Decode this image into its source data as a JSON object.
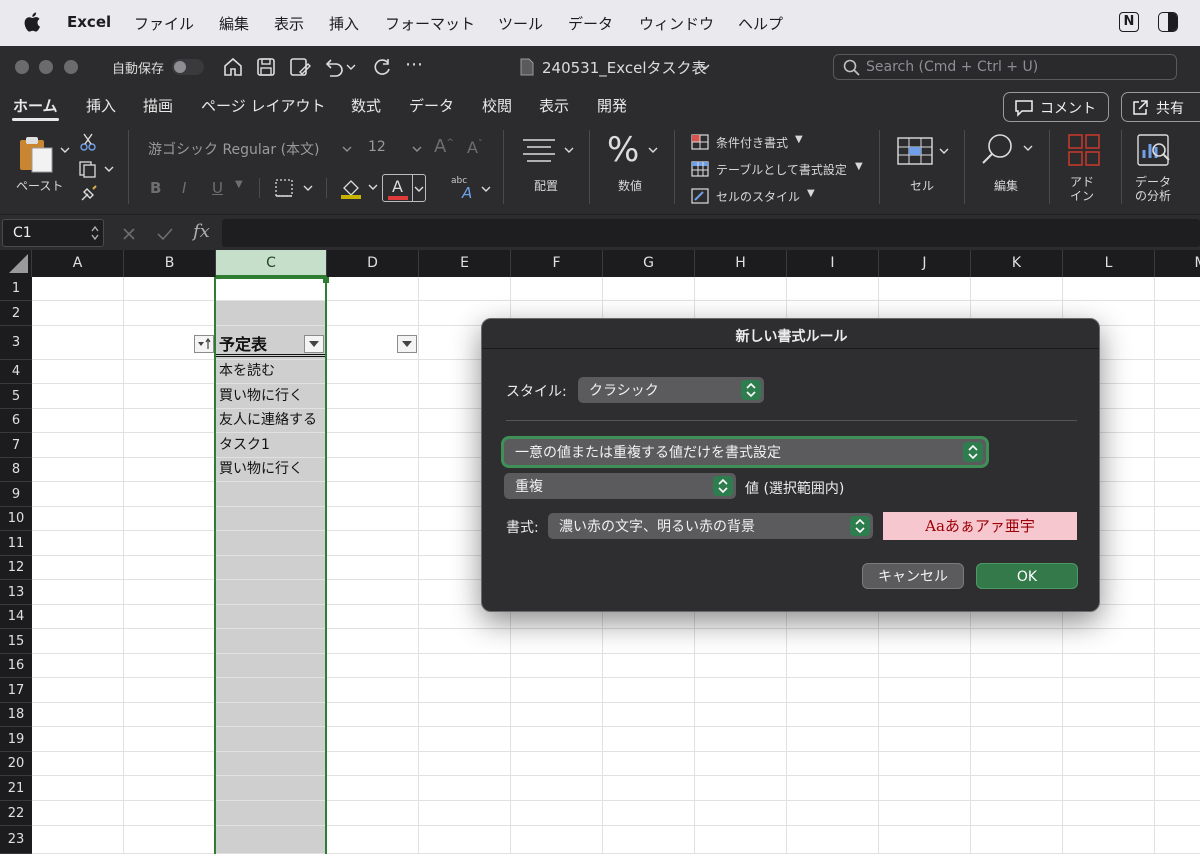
{
  "menubar": {
    "app_name": "Excel",
    "items": [
      "ファイル",
      "編集",
      "表示",
      "挿入",
      "フォーマット",
      "ツール",
      "データ",
      "ウィンドウ",
      "ヘルプ"
    ],
    "status_icons": [
      "notion-icon",
      "contrast-icon"
    ],
    "notion_letter": "N"
  },
  "titlebar": {
    "autosave_label": "自動保存",
    "document_title": "240531_Excelタスク表",
    "search_placeholder": "Search (Cmd + Ctrl + U)"
  },
  "ribbon_tabs": {
    "tabs": [
      "ホーム",
      "挿入",
      "描画",
      "ページ レイアウト",
      "数式",
      "データ",
      "校閲",
      "表示",
      "開発"
    ],
    "active_tab": "ホーム",
    "comment_label": "コメント",
    "share_label": "共有"
  },
  "ribbon": {
    "paste_label": "ペースト",
    "font_name": "游ゴシック Regular (本文)",
    "font_size": "12",
    "bold": "B",
    "italic": "I",
    "underline": "U",
    "font_color_letter": "A",
    "abc_label": "abc",
    "align_label": "配置",
    "number_label": "数値",
    "percent_symbol": "%",
    "conditional_formatting": "条件付き書式",
    "format_as_table": "テーブルとして書式設定",
    "cell_styles": "セルのスタイル",
    "cells_label": "セル",
    "editing_label": "編集",
    "addins_label": "アド\nイン",
    "analyze_label": "データ\nの分析",
    "accent_color": "#2e7d32"
  },
  "formula_bar": {
    "name_box": "C1",
    "fx": "fx",
    "formula": ""
  },
  "sheet": {
    "columns": [
      "A",
      "B",
      "C",
      "D",
      "E",
      "F",
      "G",
      "H",
      "I",
      "J",
      "K",
      "L",
      "M"
    ],
    "rows": [
      "1",
      "2",
      "3",
      "4",
      "5",
      "6",
      "7",
      "8",
      "9",
      "10",
      "11",
      "12",
      "13",
      "14",
      "15",
      "16",
      "17",
      "18",
      "19",
      "20",
      "21",
      "22",
      "23"
    ],
    "selected_column": "C",
    "header_cell": "予定表",
    "cells": [
      "本を読む",
      "買い物に行く",
      "友人に連絡する",
      "タスク1",
      "買い物に行く"
    ]
  },
  "dialog": {
    "title": "新しい書式ルール",
    "style_label": "スタイル:",
    "style_value": "クラシック",
    "rule_type": "一意の値または重複する値だけを書式設定",
    "duplicate_value": "重複",
    "value_suffix": "値 (選択範囲内)",
    "format_label": "書式:",
    "format_value": "濃い赤の文字、明るい赤の背景",
    "preview_text": "Aaあぁアァ亜宇",
    "cancel_label": "キャンセル",
    "ok_label": "OK",
    "ok_color": "#34794a",
    "preview_bg": "#f6c7ce",
    "preview_fg": "#9c0006"
  }
}
